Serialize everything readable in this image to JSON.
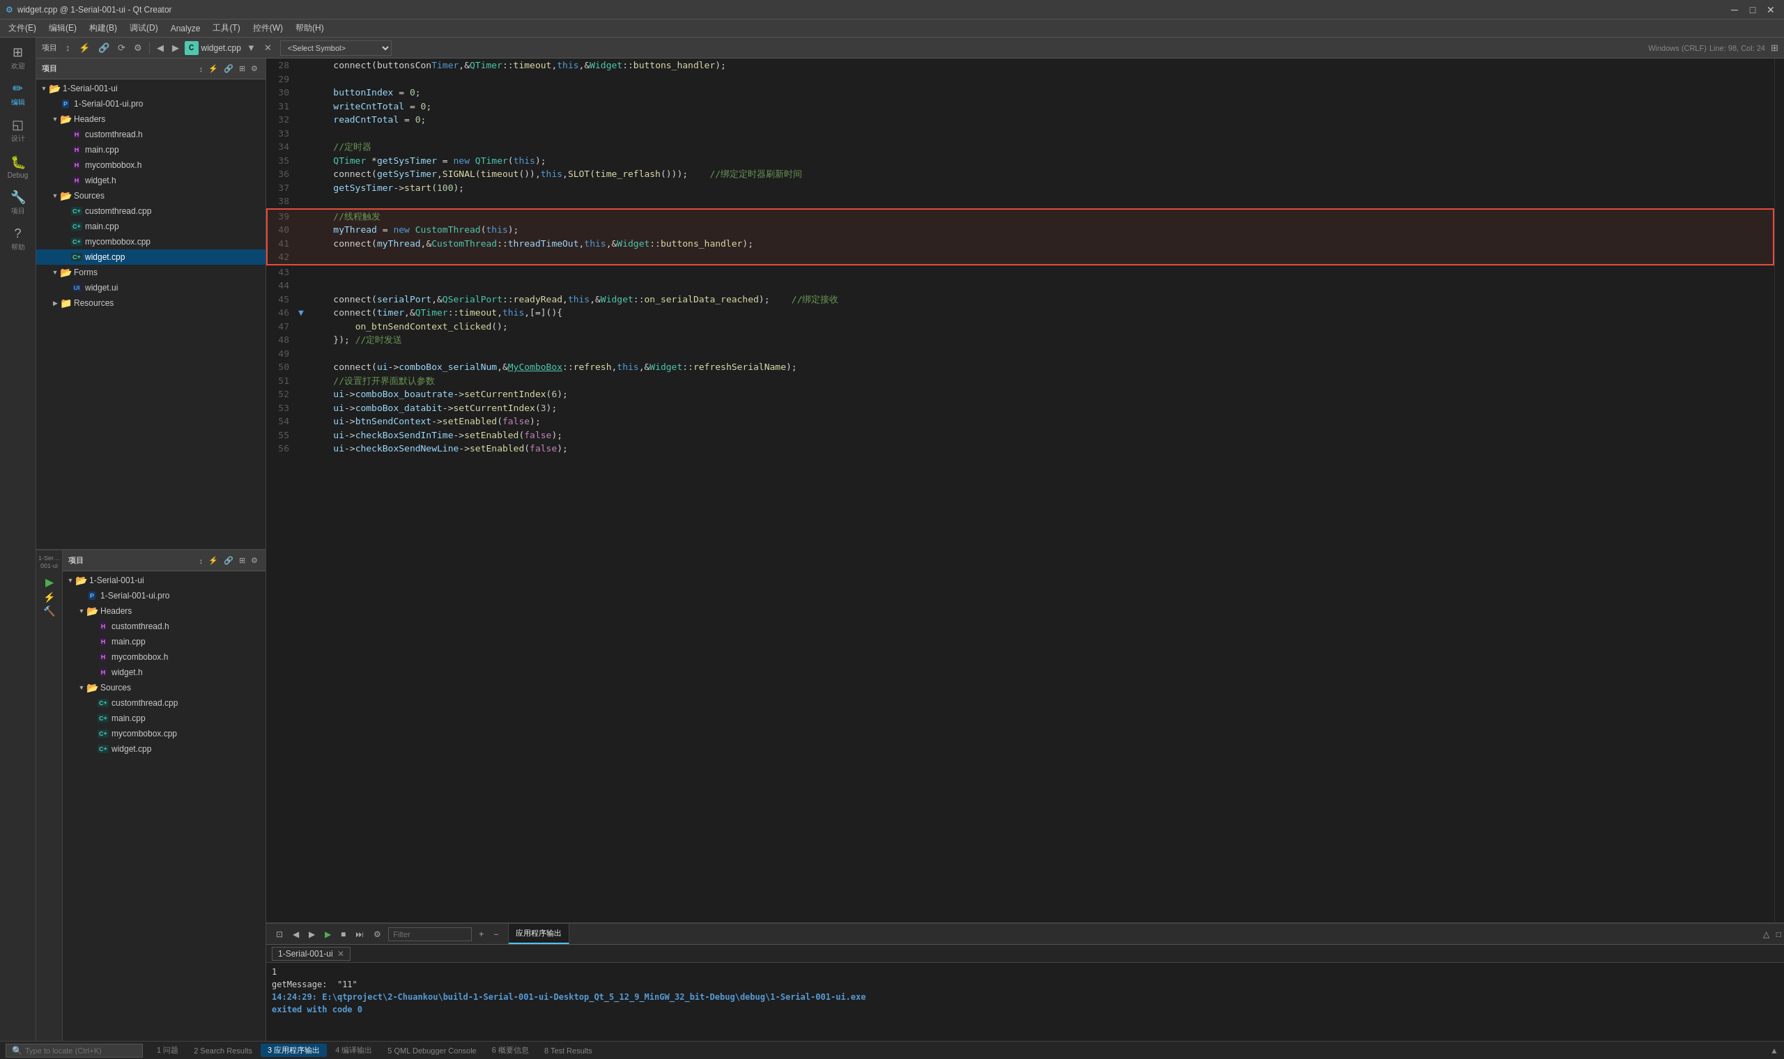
{
  "titlebar": {
    "title": "widget.cpp @ 1-Serial-001-ui - Qt Creator",
    "icon": "⚙"
  },
  "menubar": {
    "items": [
      "文件(E)",
      "编辑(E)",
      "构建(B)",
      "调试(D)",
      "Analyze",
      "工具(T)",
      "控件(W)",
      "帮助(H)"
    ]
  },
  "iconbar": {
    "items": [
      {
        "id": "welcome",
        "icon": "⊞",
        "label": "欢迎"
      },
      {
        "id": "edit",
        "icon": "✏",
        "label": "编辑",
        "active": true
      },
      {
        "id": "design",
        "icon": "◱",
        "label": "设计"
      },
      {
        "id": "debug",
        "icon": "🐛",
        "label": "Debug"
      },
      {
        "id": "project",
        "icon": "🔧",
        "label": "项目"
      },
      {
        "id": "help",
        "icon": "?",
        "label": "帮助"
      }
    ]
  },
  "top_panel": {
    "title": "项目",
    "tree": [
      {
        "id": "root1",
        "level": 0,
        "expanded": true,
        "icon": "folder",
        "name": "1-Serial-001-ui",
        "has_arrow": true
      },
      {
        "id": "pro1",
        "level": 1,
        "expanded": false,
        "icon": "pro",
        "name": "1-Serial-001-ui.pro",
        "has_arrow": false
      },
      {
        "id": "headers",
        "level": 1,
        "expanded": true,
        "icon": "folder",
        "name": "Headers",
        "has_arrow": true
      },
      {
        "id": "customthread_h",
        "level": 2,
        "expanded": false,
        "icon": "h",
        "name": "customthread.h",
        "has_arrow": false
      },
      {
        "id": "main_h",
        "level": 2,
        "expanded": false,
        "icon": "h",
        "name": "main.cpp",
        "has_arrow": false
      },
      {
        "id": "mycombobox_h",
        "level": 2,
        "expanded": false,
        "icon": "h",
        "name": "mycombobox.h",
        "has_arrow": false
      },
      {
        "id": "widget_h",
        "level": 2,
        "expanded": false,
        "icon": "h",
        "name": "widget.h",
        "has_arrow": false
      },
      {
        "id": "sources",
        "level": 1,
        "expanded": true,
        "icon": "folder",
        "name": "Sources",
        "has_arrow": true
      },
      {
        "id": "customthread_cpp",
        "level": 2,
        "expanded": false,
        "icon": "cpp",
        "name": "customthread.cpp",
        "has_arrow": false
      },
      {
        "id": "main_cpp",
        "level": 2,
        "expanded": false,
        "icon": "cpp",
        "name": "main.cpp",
        "has_arrow": false
      },
      {
        "id": "mycombobox_cpp",
        "level": 2,
        "expanded": false,
        "icon": "cpp",
        "name": "mycombobox.cpp",
        "has_arrow": false
      },
      {
        "id": "widget_cpp_top",
        "level": 2,
        "expanded": false,
        "icon": "cpp",
        "name": "widget.cpp",
        "has_arrow": false,
        "selected": true
      },
      {
        "id": "forms",
        "level": 1,
        "expanded": true,
        "icon": "folder",
        "name": "Forms",
        "has_arrow": true
      },
      {
        "id": "widget_ui",
        "level": 2,
        "expanded": false,
        "icon": "ui",
        "name": "widget.ui",
        "has_arrow": false
      },
      {
        "id": "resources",
        "level": 1,
        "expanded": false,
        "icon": "folder",
        "name": "Resources",
        "has_arrow": true
      }
    ]
  },
  "bottom_left_panel": {
    "title": "项目",
    "tree": [
      {
        "id": "root2",
        "level": 0,
        "expanded": true,
        "icon": "folder",
        "name": "1-Serial-001-ui",
        "has_arrow": true
      },
      {
        "id": "pro2",
        "level": 1,
        "expanded": false,
        "icon": "pro",
        "name": "1-Serial-001-ui.pro",
        "has_arrow": false
      },
      {
        "id": "headers2",
        "level": 1,
        "expanded": true,
        "icon": "folder",
        "name": "Headers",
        "has_arrow": true
      },
      {
        "id": "customthread_h2",
        "level": 2,
        "expanded": false,
        "icon": "h",
        "name": "customthread.h",
        "has_arrow": false
      },
      {
        "id": "main_h2",
        "level": 2,
        "expanded": false,
        "icon": "h",
        "name": "main.cpp",
        "has_arrow": false
      },
      {
        "id": "mycombobox_h2",
        "level": 2,
        "expanded": false,
        "icon": "h",
        "name": "mycombobox.h",
        "has_arrow": false
      },
      {
        "id": "widget_h2",
        "level": 2,
        "expanded": false,
        "icon": "h",
        "name": "widget.h",
        "has_arrow": false
      },
      {
        "id": "sources2",
        "level": 1,
        "expanded": true,
        "icon": "folder",
        "name": "Sources",
        "has_arrow": true
      },
      {
        "id": "customthread_cpp2",
        "level": 2,
        "expanded": false,
        "icon": "cpp",
        "name": "customthread.cpp",
        "has_arrow": false
      },
      {
        "id": "main_cpp2",
        "level": 2,
        "expanded": false,
        "icon": "cpp",
        "name": "main.cpp",
        "has_arrow": false
      },
      {
        "id": "mycombobox_cpp2",
        "level": 2,
        "expanded": false,
        "icon": "cpp",
        "name": "mycombobox.cpp",
        "has_arrow": false
      },
      {
        "id": "widget_cpp2",
        "level": 2,
        "expanded": false,
        "icon": "cpp",
        "name": "widget.cpp",
        "has_arrow": false
      }
    ]
  },
  "editor": {
    "tab": "widget.cpp",
    "symbol": "<Select Symbol>",
    "encoding": "Windows (CRLF)",
    "line": "Line: 98, Col: 24"
  },
  "code_lines": [
    {
      "num": "28",
      "has_arrow": false,
      "content": "    connect(buttonsCon<span class='kw'>Timer</span>,<span class='op'>&</span><span class='cls'>QTimer</span><span class='op'>::</span><span class='fn'>timeout</span>,<span class='kw'>this</span>,<span class='op'>&</span><span class='cls'>Widget</span><span class='op'>::</span><span class='fn'>buttons_handler</span>);"
    },
    {
      "num": "29",
      "has_arrow": false,
      "content": ""
    },
    {
      "num": "30",
      "has_arrow": false,
      "content": "    <span class='var'>buttonIndex</span> <span class='op'>=</span> <span class='num'>0</span>;"
    },
    {
      "num": "31",
      "has_arrow": false,
      "content": "    <span class='var'>writeCntTotal</span> <span class='op'>=</span> <span class='num'>0</span>;"
    },
    {
      "num": "32",
      "has_arrow": false,
      "content": "    <span class='var'>readCntTotal</span> <span class='op'>=</span> <span class='num'>0</span>;"
    },
    {
      "num": "33",
      "has_arrow": false,
      "content": ""
    },
    {
      "num": "34",
      "has_arrow": false,
      "content": "    <span class='cmt'>//定时器</span>"
    },
    {
      "num": "35",
      "has_arrow": false,
      "content": "    <span class='cls'>QTimer</span> <span class='op'>*</span><span class='var'>getSysTimer</span> <span class='op'>=</span> <span class='kw'>new</span> <span class='cls'>QTimer</span>(<span class='kw'>this</span>);"
    },
    {
      "num": "36",
      "has_arrow": false,
      "content": "    connect(<span class='var'>getSysTimer</span>,<span class='fn'>SIGNAL</span>(<span class='fn'>timeout</span>()),<span class='kw'>this</span>,<span class='fn'>SLOT</span>(<span class='fn'>time_reflash</span>()));    <span class='cmt'>//绑定定时器刷新时间</span>"
    },
    {
      "num": "37",
      "has_arrow": false,
      "content": "    <span class='var'>getSysTimer</span><span class='op'>-></span><span class='fn'>start</span>(<span class='num'>100</span>);"
    },
    {
      "num": "38",
      "has_arrow": false,
      "content": ""
    },
    {
      "num": "39",
      "has_arrow": false,
      "content": "    <span class='cmt'>//线程触发</span>",
      "highlight": true
    },
    {
      "num": "40",
      "has_arrow": false,
      "content": "    <span class='var'>myThread</span> <span class='op'>=</span> <span class='kw'>new</span> <span class='cls'>CustomThread</span>(<span class='kw'>this</span>);",
      "highlight": true
    },
    {
      "num": "41",
      "has_arrow": false,
      "content": "    connect(<span class='var'>myThread</span>,<span class='op'>&</span><span class='cls'>CustomThread</span><span class='op'>::</span><span class='var'>threadTimeOut</span>,<span class='kw'>this</span>,<span class='op'>&</span><span class='cls'>Widget</span><span class='op'>::</span><span class='fn'>buttons_handler</span>);",
      "highlight": true
    },
    {
      "num": "42",
      "has_arrow": false,
      "content": "",
      "highlight": true
    },
    {
      "num": "43",
      "has_arrow": false,
      "content": ""
    },
    {
      "num": "44",
      "has_arrow": false,
      "content": ""
    },
    {
      "num": "45",
      "has_arrow": false,
      "content": "    connect(<span class='var'>serialPort</span>,<span class='op'>&</span><span class='cls'>QSerialPort</span><span class='op'>::</span><span class='fn'>readyRead</span>,<span class='kw'>this</span>,<span class='op'>&</span><span class='cls'>Widget</span><span class='op'>::</span><span class='fn'>on_serialData_reached</span>);    <span class='cmt'>//绑定接收</span>"
    },
    {
      "num": "46",
      "has_arrow": true,
      "content": "    connect(<span class='var'>timer</span>,<span class='op'>&</span><span class='cls'>QTimer</span><span class='op'>::</span><span class='fn'>timeout</span>,<span class='kw'>this</span>,[<span class='op'>=</span>](){"
    },
    {
      "num": "47",
      "has_arrow": false,
      "content": "        <span class='fn'>on_btnSendContext_clicked</span>();"
    },
    {
      "num": "48",
      "has_arrow": false,
      "content": "    }); <span class='cmt'>//定时发送</span>"
    },
    {
      "num": "49",
      "has_arrow": false,
      "content": ""
    },
    {
      "num": "50",
      "has_arrow": false,
      "content": "    connect(<span class='var'>ui</span><span class='op'>-></span><span class='var'>comboBox_serialNum</span>,<span class='op'>&</span><span class='link'>MyComboBox</span><span class='op'>::</span><span class='fn'>refresh</span>,<span class='kw'>this</span>,<span class='op'>&</span><span class='cls'>Widget</span><span class='op'>::</span><span class='fn'>refreshSerialName</span>);"
    },
    {
      "num": "51",
      "has_arrow": false,
      "content": "    <span class='cmt'>//设置打开界面默认参数</span>"
    },
    {
      "num": "52",
      "has_arrow": false,
      "content": "    <span class='var'>ui</span><span class='op'>-></span><span class='var'>comboBox_boautrate</span><span class='op'>-></span><span class='fn'>setCurrentIndex</span>(<span class='num'>6</span>);"
    },
    {
      "num": "53",
      "has_arrow": false,
      "content": "    <span class='var'>ui</span><span class='op'>-></span><span class='var'>comboBox_databit</span><span class='op'>-></span><span class='fn'>setCurrentIndex</span>(<span class='num'>3</span>);"
    },
    {
      "num": "54",
      "has_arrow": false,
      "content": "    <span class='var'>ui</span><span class='op'>-></span><span class='var'>btnSendContext</span><span class='op'>-></span><span class='fn'>setEnabled</span>(<span class='kw2'>false</span>);"
    },
    {
      "num": "55",
      "has_arrow": false,
      "content": "    <span class='var'>ui</span><span class='op'>-></span><span class='var'>checkBoxSendInTime</span><span class='op'>-></span><span class='fn'>setEnabled</span>(<span class='kw2'>false</span>);"
    },
    {
      "num": "56",
      "has_arrow": false,
      "content": "    <span class='var'>ui</span><span class='op'>-></span><span class='var'>checkBoxSendNewLine</span><span class='op'>-></span><span class='fn'>setEnabled</span>(<span class='kw2'>false</span>);"
    }
  ],
  "output_panel": {
    "tabs": [
      {
        "id": "app-output",
        "label": "应用程序输出",
        "active": true,
        "closable": true
      },
      {
        "id": "compile",
        "label": "",
        "active": false
      }
    ],
    "app_tab": "1-Serial-001-ui",
    "lines": [
      {
        "type": "normal",
        "text": "1"
      },
      {
        "type": "normal",
        "text": "getMessage:  \"11\""
      },
      {
        "type": "bold",
        "text": "14:24:29: E:\\qtproject\\2-Chuankou\\build-1-Serial-001-ui-Desktop_Qt_5_12_9_MinGW_32_bit-Debug\\debug\\1-Serial-001-ui.exe"
      },
      {
        "type": "bold",
        "text": "exited with code 0"
      }
    ]
  },
  "statusbar": {
    "bottom_tabs": [
      {
        "id": "issues",
        "label": "1 问题",
        "num": 1
      },
      {
        "id": "search",
        "label": "2 Search Results",
        "num": 2
      },
      {
        "id": "app-out",
        "label": "3 应用程序输出",
        "num": 3,
        "active": true
      },
      {
        "id": "compile-out",
        "label": "4 编译输出",
        "num": 4
      },
      {
        "id": "qml",
        "label": "5 QML Debugger Console",
        "num": 5
      },
      {
        "id": "overview",
        "label": "6 概要信息",
        "num": 6
      },
      {
        "id": "test",
        "label": "8 Test Results",
        "num": 8
      }
    ],
    "search_placeholder": "Type to locate (Ctrl+K)"
  },
  "left_run_panel": {
    "label": "1-Ser…001-ui",
    "buttons": [
      "run",
      "debug-run",
      "build"
    ]
  }
}
